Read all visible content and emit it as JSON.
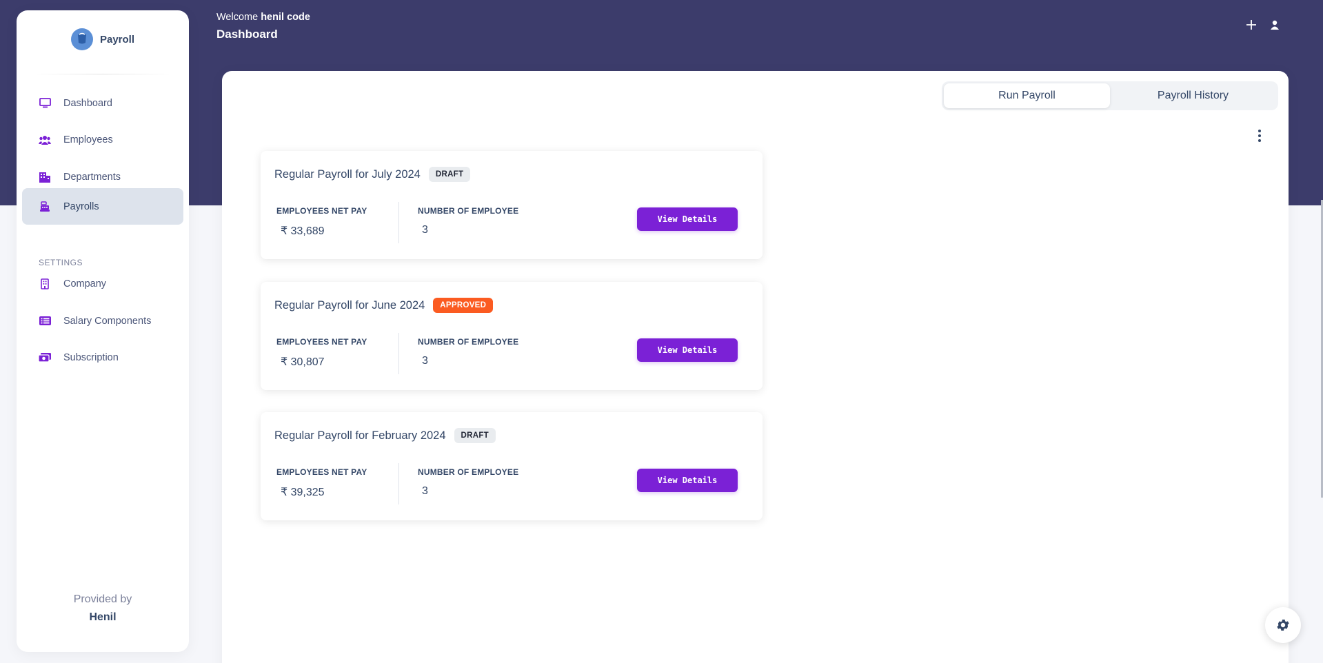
{
  "brand": {
    "name": "Payroll"
  },
  "header": {
    "welcome_prefix": "Welcome",
    "user_name": "henil code",
    "page_title": "Dashboard"
  },
  "sidebar": {
    "items": [
      {
        "label": "Dashboard",
        "icon": "monitor-icon"
      },
      {
        "label": "Employees",
        "icon": "users-icon"
      },
      {
        "label": "Departments",
        "icon": "building-icon"
      },
      {
        "label": "Payrolls",
        "icon": "cash-register-icon",
        "active": true
      }
    ],
    "settings_title": "SETTINGS",
    "settings_items": [
      {
        "label": "Company",
        "icon": "office-icon"
      },
      {
        "label": "Salary Components",
        "icon": "list-icon"
      },
      {
        "label": "Subscription",
        "icon": "money-icon"
      }
    ],
    "provided_by": "Provided by",
    "provider": "Henil"
  },
  "tabs": [
    {
      "label": "Run Payroll",
      "active": true
    },
    {
      "label": "Payroll History",
      "active": false
    }
  ],
  "payrolls": [
    {
      "title": "Regular Payroll for July 2024",
      "status": "DRAFT",
      "net_pay_label": "EMPLOYEES NET PAY",
      "net_pay": "₹ 33,689",
      "employees_label": "NUMBER OF EMPLOYEE",
      "employees": "3",
      "button": "View Details"
    },
    {
      "title": "Regular Payroll for June 2024",
      "status": "APPROVED",
      "net_pay_label": "EMPLOYEES NET PAY",
      "net_pay": "₹ 30,807",
      "employees_label": "NUMBER OF EMPLOYEE",
      "employees": "3",
      "button": "View Details"
    },
    {
      "title": "Regular Payroll for February 2024",
      "status": "DRAFT",
      "net_pay_label": "EMPLOYEES NET PAY",
      "net_pay": "₹ 39,325",
      "employees_label": "NUMBER OF EMPLOYEE",
      "employees": "3",
      "button": "View Details"
    }
  ],
  "colors": {
    "header_bg": "#3c3c6b",
    "accent": "#7b21d6",
    "approved": "#fb5b21",
    "draft_bg": "#e9ecef"
  }
}
